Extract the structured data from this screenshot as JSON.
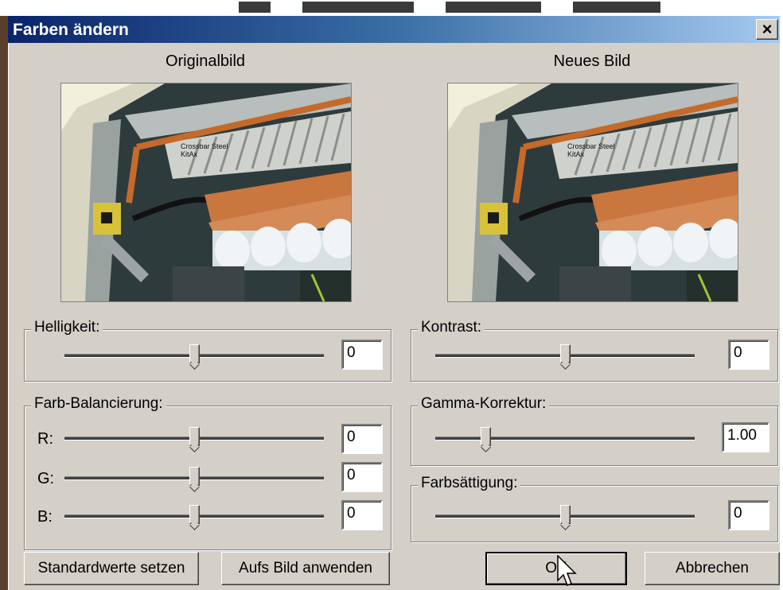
{
  "window": {
    "title": "Farben ändern",
    "close_glyph": "×"
  },
  "preview": {
    "original_label": "Originalbild",
    "new_label": "Neues Bild",
    "image_text_line1": "Crossbar Steel",
    "image_text_line2": "KitAx"
  },
  "brightness": {
    "label": "Helligkeit:",
    "value": "0",
    "level": 0.5
  },
  "contrast": {
    "label": "Kontrast:",
    "value": "0",
    "level": 0.5
  },
  "color_balance": {
    "label": "Farb-Balancierung:",
    "channels": [
      {
        "label": "R:",
        "value": "0",
        "level": 0.5
      },
      {
        "label": "G:",
        "value": "0",
        "level": 0.5
      },
      {
        "label": "B:",
        "value": "0",
        "level": 0.5
      }
    ]
  },
  "gamma": {
    "label": "Gamma-Korrektur:",
    "value": "1.00",
    "level": 0.18
  },
  "saturation": {
    "label": "Farbsättigung:",
    "value": "0",
    "level": 0.5
  },
  "buttons": {
    "defaults": "Standardwerte setzen",
    "apply": "Aufs Bild anwenden",
    "ok": "OK",
    "cancel": "Abbrechen"
  },
  "icons": {
    "close": "close-icon",
    "cursor": "mouse-pointer-icon",
    "slider_thumb": "slider-thumb"
  }
}
